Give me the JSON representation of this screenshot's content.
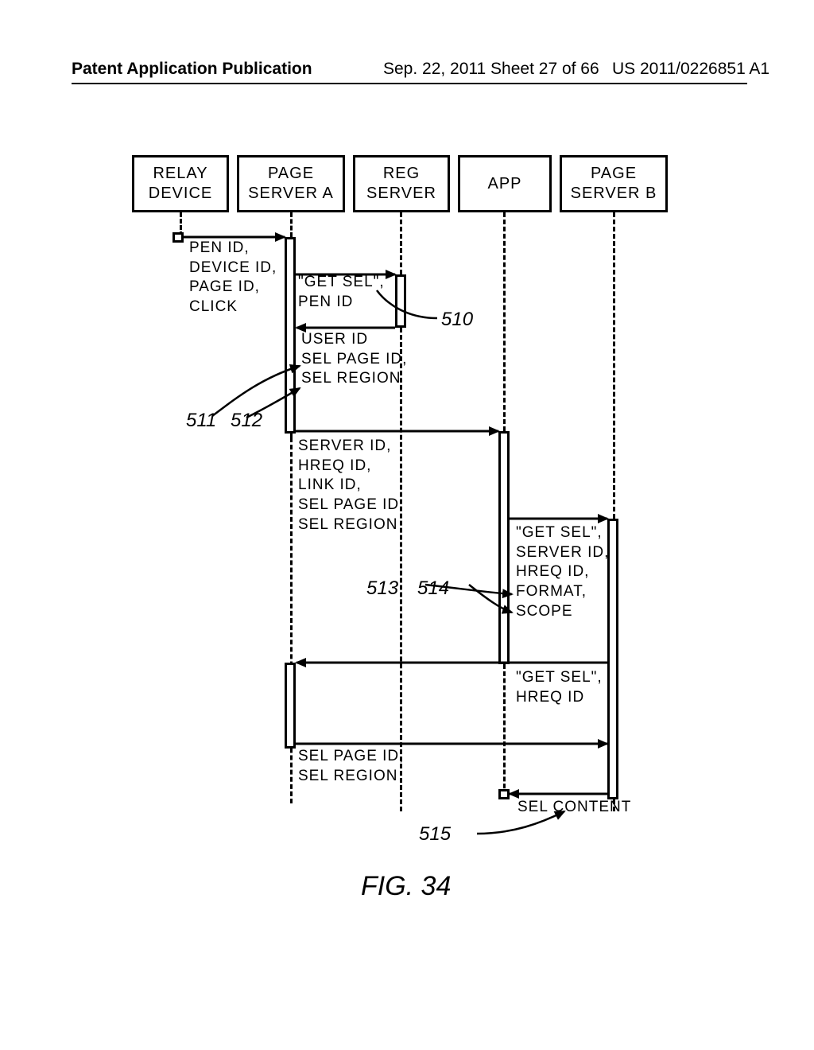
{
  "header": {
    "left": "Patent Application Publication",
    "mid": "Sep. 22, 2011  Sheet 27 of 66",
    "right": "US 2011/0226851 A1"
  },
  "participants": {
    "relay": "RELAY\nDEVICE",
    "pageA": "PAGE\nSERVER A",
    "reg": "REG\nSERVER",
    "app": "APP",
    "pageB": "PAGE\nSERVER B"
  },
  "messages": {
    "m1": "PEN ID,\nDEVICE ID,\nPAGE ID,\nCLICK",
    "m2": "\"GET SEL\",\nPEN ID",
    "m3": "USER ID\nSEL PAGE ID,\nSEL REGION",
    "m4": "SERVER ID,\nHREQ ID,\nLINK ID,\nSEL PAGE ID,\nSEL REGION",
    "m5": "\"GET SEL\",\nSERVER ID,\nHREQ ID,\nFORMAT,\nSCOPE",
    "m6": "\"GET SEL\",\nHREQ ID",
    "m7": "SEL PAGE ID,\nSEL REGION",
    "m8": "SEL CONTENT"
  },
  "refs": {
    "r510": "510",
    "r511": "511",
    "r512": "512",
    "r513": "513",
    "r514": "514",
    "r515": "515"
  },
  "caption": "FIG. 34"
}
